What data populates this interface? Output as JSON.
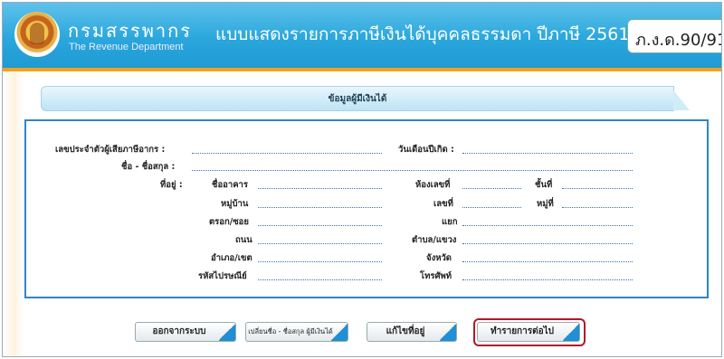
{
  "header": {
    "org_name_th": "กรมสรรพากร",
    "org_name_en": "The Revenue Department",
    "form_title": "แบบแสดงรายการภาษีเงินได้บุคคลธรรมดา ปีภาษี 2561",
    "form_code": "ภ.ง.ด.90/91"
  },
  "section": {
    "title": "ข้อมูลผู้มีเงินได้"
  },
  "form": {
    "tax_id_label": "เลขประจำตัวผู้เสียภาษีอากร :",
    "birthdate_label": "วันเดือนปีเกิด :",
    "name_label": "ชื่อ - ชื่อสกุล :",
    "address_label": "ที่อยู่ :",
    "building_label": "ชื่ออาคาร",
    "room_label": "ห้องเลขที่",
    "floor_label": "ชั้นที่",
    "village_label": "หมู่บ้าน",
    "house_no_label": "เลขที่",
    "moo_label": "หมู่ที่",
    "soi_label": "ตรอก/ซอย",
    "junction_label": "แยก",
    "road_label": "ถนน",
    "subdistrict_label": "ตำบล/แขวง",
    "district_label": "อำเภอ/เขต",
    "province_label": "จังหวัด",
    "postcode_label": "รหัสไปรษณีย์",
    "phone_label": "โทรศัพท์"
  },
  "buttons": {
    "exit": "ออกจากระบบ",
    "change_name": "เปลี่ยนชื่อ - ชื่อสกุล ผู้มีเงินได้",
    "edit_address": "แก้ไขที่อยู่",
    "next": "ทำรายการต่อไป"
  }
}
